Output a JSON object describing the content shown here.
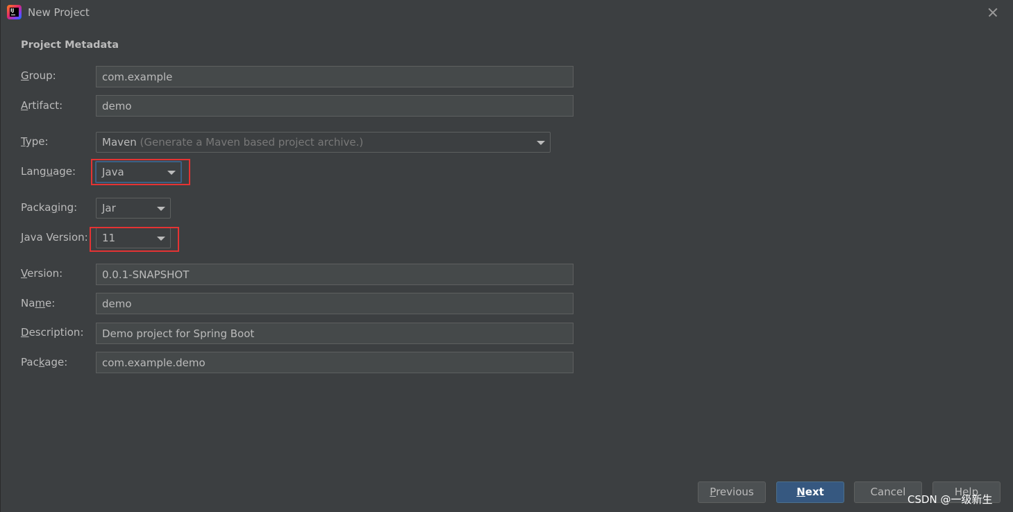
{
  "window": {
    "title": "New Project"
  },
  "section_title": "Project Metadata",
  "fields": {
    "group": {
      "label_u": "G",
      "label_rest": "roup:",
      "value": "com.example"
    },
    "artifact": {
      "label_u": "A",
      "label_rest": "rtifact:",
      "value": "demo"
    },
    "type": {
      "label_u": "T",
      "label_rest": "ype:",
      "value": "Maven",
      "hint": "(Generate a Maven based project archive.)"
    },
    "language": {
      "label_pre": "Lang",
      "label_u": "u",
      "label_rest": "age:",
      "value": "Java"
    },
    "packaging": {
      "label_pre": "Packa",
      "label_u": "g",
      "label_rest": "ing:",
      "value": "Jar"
    },
    "java_version": {
      "label_u": "J",
      "label_rest": "ava Version:",
      "value": "11"
    },
    "version": {
      "label_u": "V",
      "label_rest": "ersion:",
      "value": "0.0.1-SNAPSHOT"
    },
    "name": {
      "label_pre": "Na",
      "label_u": "m",
      "label_rest": "e:",
      "value": "demo"
    },
    "description": {
      "label_u": "D",
      "label_rest": "escription:",
      "value": "Demo project for Spring Boot"
    },
    "package": {
      "label_pre": "Pac",
      "label_u": "k",
      "label_rest": "age:",
      "value": "com.example.demo"
    }
  },
  "buttons": {
    "previous": {
      "u": "P",
      "rest": "revious"
    },
    "next": {
      "u": "N",
      "rest": "ext"
    },
    "cancel": "Cancel",
    "help": "Help"
  },
  "watermark": "CSDN @一级新生",
  "colors": {
    "highlight": "#e53333",
    "primary_button": "#365880",
    "background": "#3c3f41"
  }
}
